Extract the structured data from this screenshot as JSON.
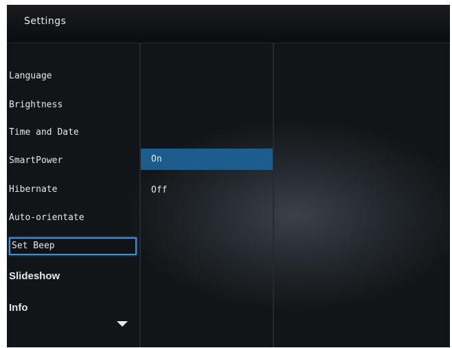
{
  "header": {
    "title": "Settings"
  },
  "menu": {
    "items": [
      {
        "label": "Language"
      },
      {
        "label": "Brightness"
      },
      {
        "label": "Time and Date"
      },
      {
        "label": "SmartPower"
      },
      {
        "label": "Hibernate"
      },
      {
        "label": "Auto-orientate"
      },
      {
        "label": "Set Beep"
      },
      {
        "label": "Slideshow"
      },
      {
        "label": "Info"
      }
    ],
    "selected": "Set Beep",
    "more_icon": "triangle-down-icon"
  },
  "options": {
    "items": [
      {
        "label": "On"
      },
      {
        "label": "Off"
      }
    ],
    "highlighted": "On"
  },
  "colors": {
    "selection_border": "#3d8fd6",
    "highlight": "#1d5d8e"
  }
}
